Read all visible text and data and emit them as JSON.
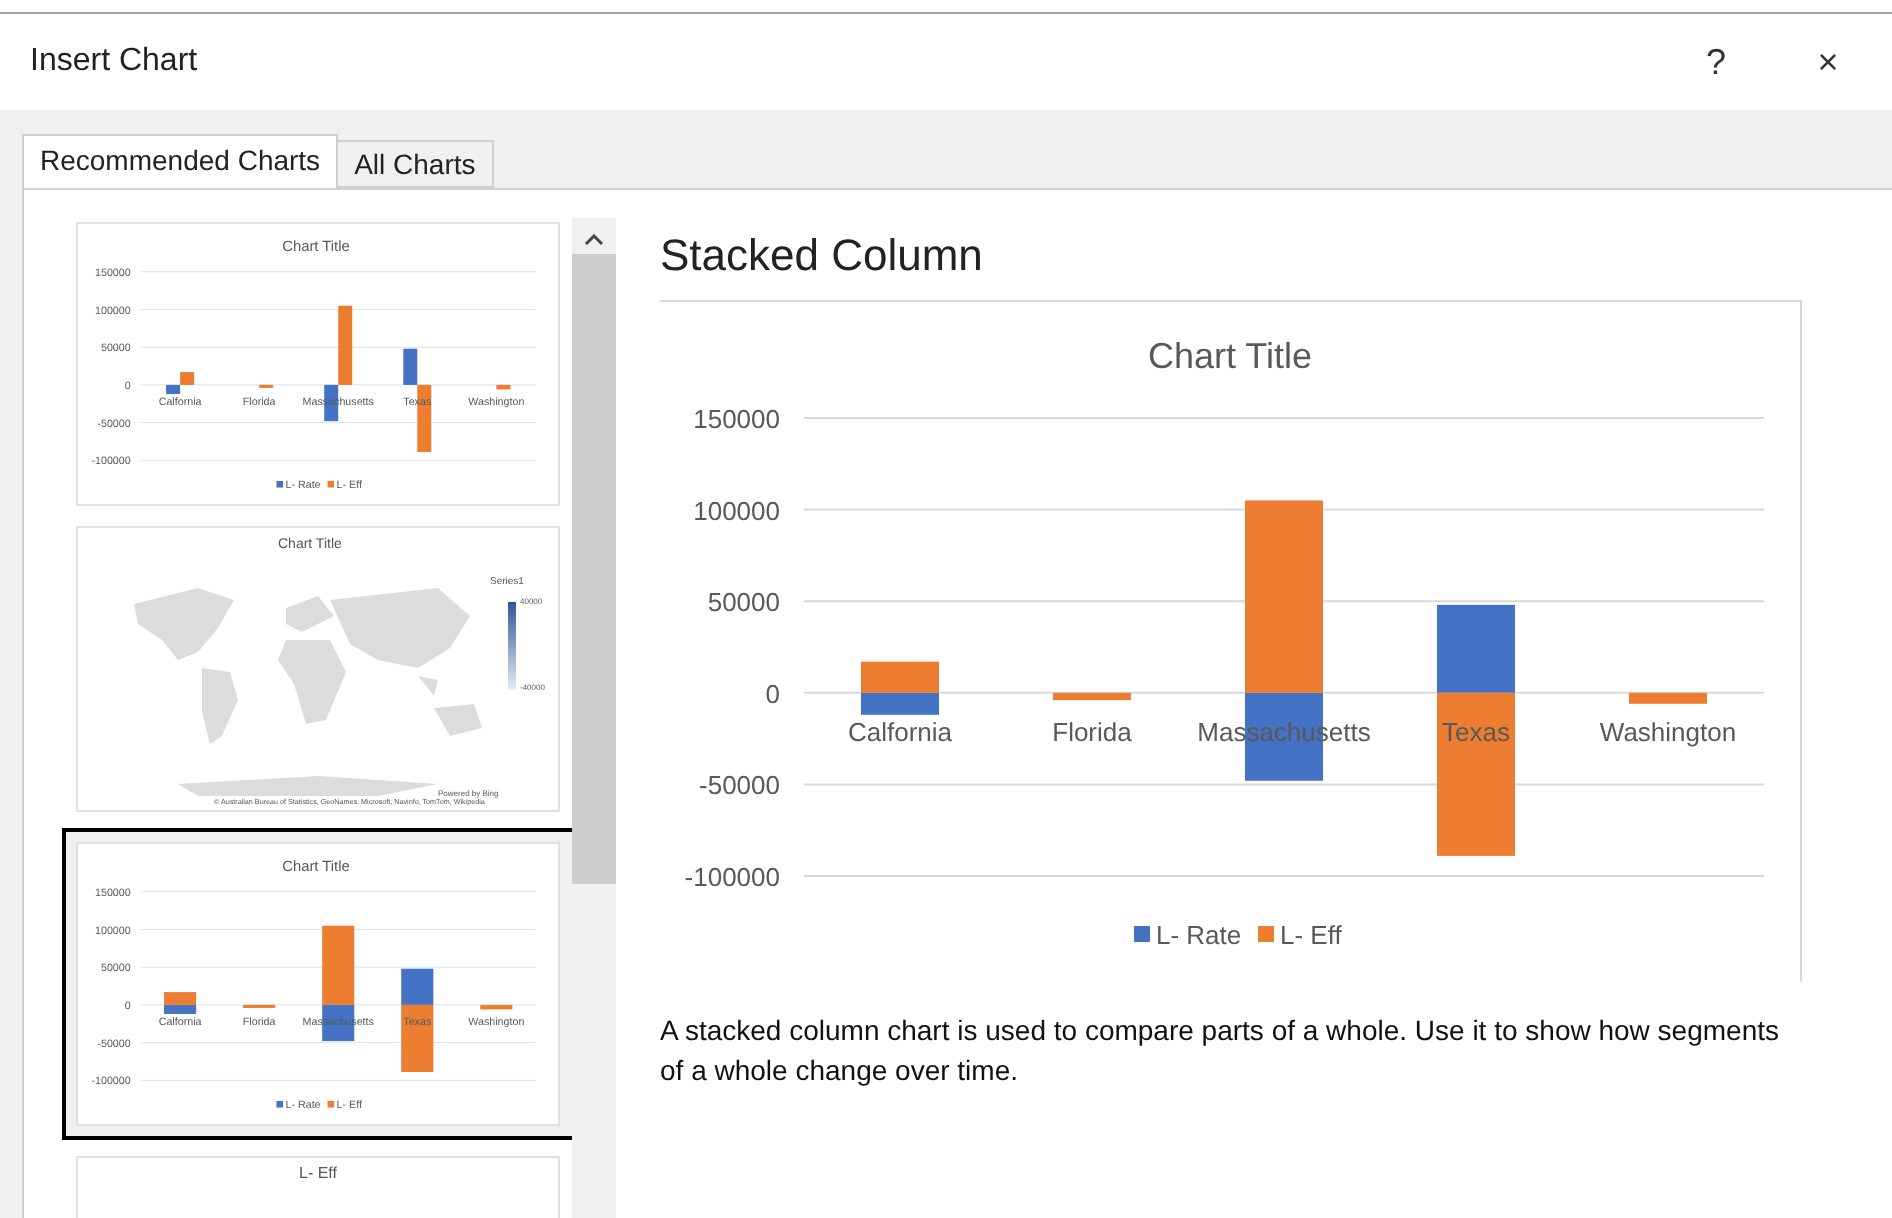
{
  "window": {
    "title": "Insert Chart",
    "help": "?",
    "close": "×"
  },
  "tabs": [
    {
      "label": "Recommended Charts",
      "selected": true
    },
    {
      "label": "All Charts",
      "selected": false
    }
  ],
  "thumbnails": [
    {
      "kind": "chart",
      "selected": false,
      "chart_data": {
        "type": "bar",
        "title": "Chart Title",
        "grid": true,
        "legend": true,
        "stacked": false,
        "categories": [
          "Calfornia",
          "Florida",
          "Massachusetts",
          "Texas",
          "Washington"
        ],
        "series": [
          {
            "name": "L- Rate",
            "color": "#4472c4",
            "values": [
              -12000,
              0,
              -48000,
              48000,
              0
            ]
          },
          {
            "name": "L- Eff",
            "color": "#ed7d31",
            "values": [
              17000,
              -4000,
              105000,
              -89000,
              -6000
            ]
          }
        ],
        "ylim": [
          -100000,
          150000
        ],
        "yticks": [
          150000,
          100000,
          50000,
          0,
          -50000,
          -100000
        ]
      }
    },
    {
      "kind": "map",
      "selected": false,
      "title": "Chart Title",
      "legend_title": "Series1",
      "legend_max": "40000",
      "legend_min": "-40000",
      "credit": "Powered by Bing",
      "attribution": "© Australian Bureau of Statistics, GeoNames, Microsoft, Navinfo, TomTom, Wikipedia"
    },
    {
      "kind": "chart",
      "selected": true,
      "chart_data": {
        "type": "bar",
        "title": "Chart Title",
        "grid": true,
        "legend": true,
        "stacked": true,
        "categories": [
          "Calfornia",
          "Florida",
          "Massachusetts",
          "Texas",
          "Washington"
        ],
        "series": [
          {
            "name": "L- Rate",
            "color": "#4472c4",
            "values": [
              -12000,
              0,
              -48000,
              48000,
              0
            ]
          },
          {
            "name": "L- Eff",
            "color": "#ed7d31",
            "values": [
              17000,
              -4000,
              105000,
              -89000,
              -6000
            ]
          }
        ],
        "ylim": [
          -100000,
          150000
        ],
        "yticks": [
          150000,
          100000,
          50000,
          0,
          -50000,
          -100000
        ]
      }
    },
    {
      "kind": "partial",
      "selected": false,
      "title": "L- Eff"
    }
  ],
  "preview": {
    "name": "Stacked Column",
    "chart_data": {
      "type": "bar",
      "title": "Chart Title",
      "grid": true,
      "legend": true,
      "stacked": true,
      "categories": [
        "Calfornia",
        "Florida",
        "Massachusetts",
        "Texas",
        "Washington"
      ],
      "series": [
        {
          "name": "L- Rate",
          "color": "#4472c4",
          "values": [
            -12000,
            0,
            -48000,
            48000,
            0
          ]
        },
        {
          "name": "L- Eff",
          "color": "#ed7d31",
          "values": [
            17000,
            -4000,
            105000,
            -89000,
            -6000
          ]
        }
      ],
      "ylim": [
        -100000,
        150000
      ],
      "yticks": [
        150000,
        100000,
        50000,
        0,
        -50000,
        -100000
      ]
    },
    "description": "A stacked column chart is used to compare parts of a whole. Use it to show how segments of a whole change over time."
  }
}
